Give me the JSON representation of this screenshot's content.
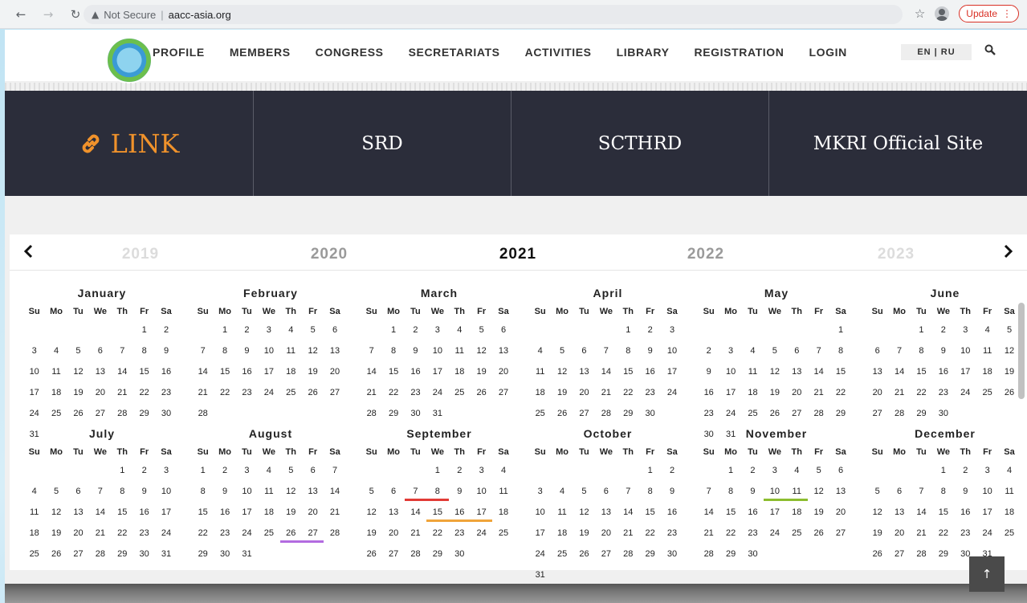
{
  "browser": {
    "security_label": "Not Secure",
    "url": "aacc-asia.org",
    "update_label": "Update",
    "icons": [
      "back-icon",
      "forward-icon",
      "reload-icon",
      "warning-icon",
      "star-icon",
      "profile-icon",
      "menu-dots-icon"
    ]
  },
  "nav": {
    "items": [
      "PROFILE",
      "MEMBERS",
      "CONGRESS",
      "SECRETARIATS",
      "ACTIVITIES",
      "LIBRARY",
      "REGISTRATION",
      "LOGIN"
    ],
    "lang": "EN | RU"
  },
  "links": {
    "title": "LINK",
    "items": [
      "SRD",
      "SCTHRD",
      "MKRI Official Site"
    ]
  },
  "calendar": {
    "years": [
      "2019",
      "2020",
      "2021",
      "2022",
      "2023"
    ],
    "dow": [
      "Su",
      "Mo",
      "Tu",
      "We",
      "Th",
      "Fr",
      "Sa"
    ],
    "months": [
      {
        "name": "January",
        "offset": 5,
        "days": 31
      },
      {
        "name": "February",
        "offset": 1,
        "days": 28
      },
      {
        "name": "March",
        "offset": 1,
        "days": 31
      },
      {
        "name": "April",
        "offset": 4,
        "days": 30
      },
      {
        "name": "May",
        "offset": 6,
        "days": 31
      },
      {
        "name": "June",
        "offset": 2,
        "days": 30
      },
      {
        "name": "July",
        "offset": 4,
        "days": 31
      },
      {
        "name": "August",
        "offset": 0,
        "days": 31
      },
      {
        "name": "September",
        "offset": 3,
        "days": 30
      },
      {
        "name": "October",
        "offset": 5,
        "days": 31
      },
      {
        "name": "November",
        "offset": 1,
        "days": 30
      },
      {
        "name": "December",
        "offset": 3,
        "days": 31
      }
    ],
    "highlights": [
      {
        "month": 7,
        "days": [
          26,
          27
        ],
        "color": "purple"
      },
      {
        "month": 8,
        "days": [
          7,
          8
        ],
        "color": "red"
      },
      {
        "month": 8,
        "days": [
          15,
          16,
          17
        ],
        "color": "orange"
      },
      {
        "month": 10,
        "days": [
          10,
          11
        ],
        "color": "green"
      }
    ]
  },
  "back_to_top": "↑"
}
